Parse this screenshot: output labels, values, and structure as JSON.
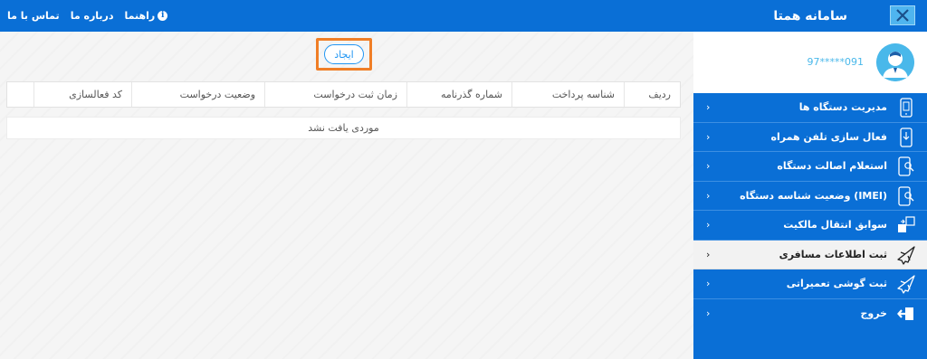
{
  "header": {
    "app_title": "سامانه همتا",
    "links": [
      {
        "label": "راهنما"
      },
      {
        "label": "درباره ما"
      },
      {
        "label": "تماس با ما"
      }
    ]
  },
  "user": {
    "phone_masked": "97*****091"
  },
  "sidebar": {
    "items": [
      {
        "label": "مدیریت دستگاه ها",
        "icon": "phone-device-icon"
      },
      {
        "label": "فعال سازی تلفن همراه",
        "icon": "phone-download-icon"
      },
      {
        "label": "استعلام اصالت دستگاه",
        "icon": "phone-search-icon"
      },
      {
        "label": "وضعیت شناسه دستگاه (IMEI)",
        "icon": "phone-search-icon"
      },
      {
        "label": "سوابق انتقال مالکیت",
        "icon": "transfer-icon"
      },
      {
        "label": "ثبت اطلاعات مسافری",
        "icon": "airplane-icon"
      },
      {
        "label": "ثبت گوشی تعمیراتی",
        "icon": "airplane-icon"
      },
      {
        "label": "خروج",
        "icon": "logout-icon"
      }
    ],
    "active_index": 5
  },
  "main": {
    "create_label": "ایجاد",
    "columns": [
      "ردیف",
      "شناسه پرداخت",
      "شماره گذرنامه",
      "زمان ثبت درخواست",
      "وضعیت درخواست",
      "کد فعالسازی",
      ""
    ],
    "empty_message": "موردی یافت نشد"
  },
  "colors": {
    "primary": "#0a6fd6",
    "highlight": "#f07e26",
    "accent": "#49b8ea"
  }
}
